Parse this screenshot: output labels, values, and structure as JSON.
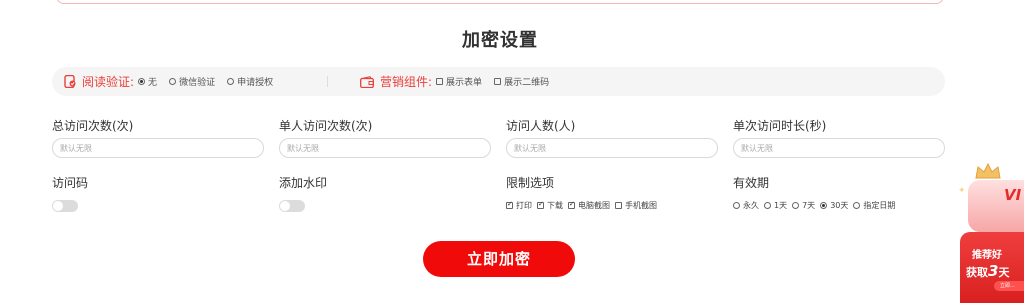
{
  "title": "加密设置",
  "read_verify": {
    "label": "阅读验证:",
    "options": [
      "无",
      "微信验证",
      "申请授权"
    ],
    "selected": "无"
  },
  "marketing": {
    "label": "营销组件:",
    "options": [
      "展示表单",
      "展示二维码"
    ]
  },
  "fields": {
    "total_visits": {
      "label": "总访问次数(次)",
      "placeholder": "默认无限"
    },
    "single_visits": {
      "label": "单人访问次数(次)",
      "placeholder": "默认无限"
    },
    "visitors": {
      "label": "访问人数(人)",
      "placeholder": "默认无限"
    },
    "duration": {
      "label": "单次访问时长(秒)",
      "placeholder": "默认无限"
    }
  },
  "access_code": {
    "label": "访问码"
  },
  "watermark": {
    "label": "添加水印"
  },
  "restrict": {
    "label": "限制选项",
    "options": [
      "打印",
      "下载",
      "电脑截图",
      "手机截图"
    ],
    "checked": [
      "打印",
      "下载",
      "电脑截图"
    ]
  },
  "validity": {
    "label": "有效期",
    "options": [
      "永久",
      "1天",
      "7天",
      "30天",
      "指定日期"
    ],
    "selected": "30天"
  },
  "submit_label": "立即加密",
  "promo": {
    "vip": "VI",
    "line1": "推荐好",
    "line2_prefix": "获取",
    "line2_num": "3",
    "line2_suffix": "天",
    "button": "立即..."
  },
  "colors": {
    "accent": "#f00a0a",
    "label_red": "#e8403b"
  }
}
